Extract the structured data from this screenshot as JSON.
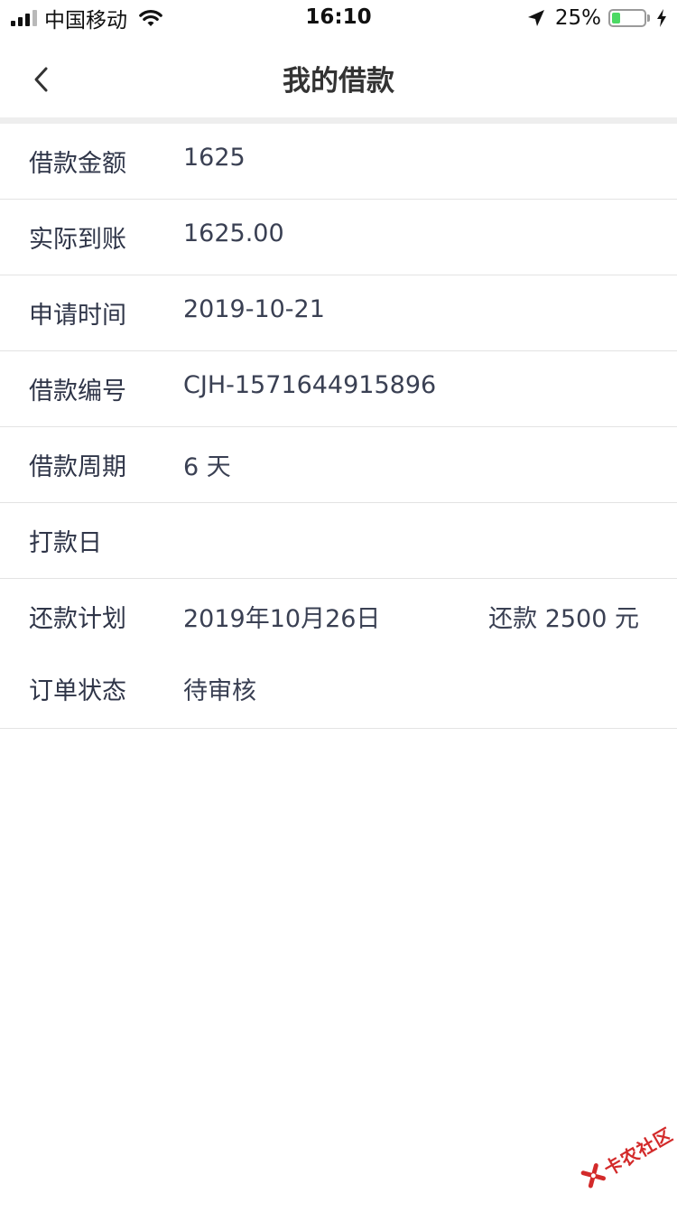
{
  "status_bar": {
    "carrier": "中国移动",
    "time": "16:10",
    "battery_percent": "25%",
    "battery_level": 0.25,
    "icons": [
      "signal-icon",
      "wifi-icon",
      "location-arrow-icon",
      "battery-icon",
      "charging-bolt-icon"
    ]
  },
  "nav": {
    "title": "我的借款",
    "back_icon": "chevron-left-icon"
  },
  "rows": {
    "amount": {
      "label": "借款金额",
      "value": "1625"
    },
    "received": {
      "label": "实际到账",
      "value": "1625.00"
    },
    "apply_time": {
      "label": "申请时间",
      "value": "2019-10-21"
    },
    "loan_no": {
      "label": "借款编号",
      "value": "CJH-1571644915896"
    },
    "period": {
      "label": "借款周期",
      "value": "6 天"
    },
    "pay_day": {
      "label": "打款日",
      "value": ""
    },
    "plan": {
      "label": "还款计划",
      "value": "2019年10月26日",
      "extra": "还款 2500 元"
    },
    "status": {
      "label": "订单状态",
      "value": "待审核"
    }
  },
  "watermark": {
    "text": "卡农社区",
    "color": "#d32a2a"
  },
  "colors": {
    "text": "#2f3548",
    "divider": "#e3e3e3",
    "section_gap": "#eeeeee",
    "battery_fill": "#4cd964"
  }
}
